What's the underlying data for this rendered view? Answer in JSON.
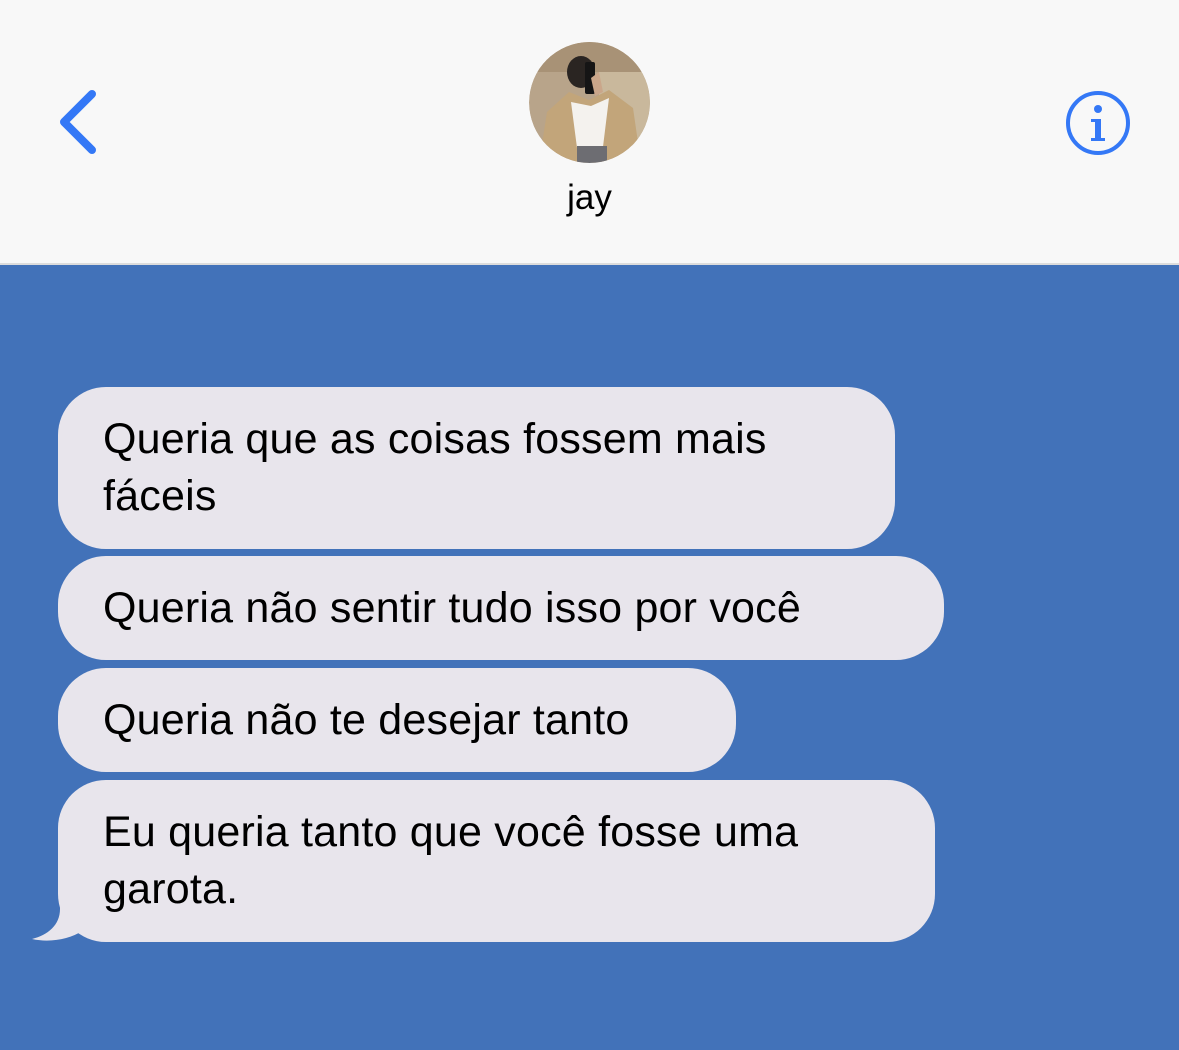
{
  "header": {
    "contact_name": "jay",
    "back_icon": "chevron-left-icon",
    "info_icon": "info-icon"
  },
  "colors": {
    "header_bg": "#f8f8f8",
    "chat_bg": "#4272b9",
    "bubble_bg": "#e8e5ec",
    "accent": "#3478f6"
  },
  "messages": [
    {
      "text": "Queria que as coisas fossem mais fáceis",
      "direction": "incoming"
    },
    {
      "text": "Queria não sentir tudo isso por você",
      "direction": "incoming"
    },
    {
      "text": "Queria não te desejar tanto",
      "direction": "incoming"
    },
    {
      "text": "Eu queria tanto que você fosse uma garota.",
      "direction": "incoming"
    }
  ]
}
